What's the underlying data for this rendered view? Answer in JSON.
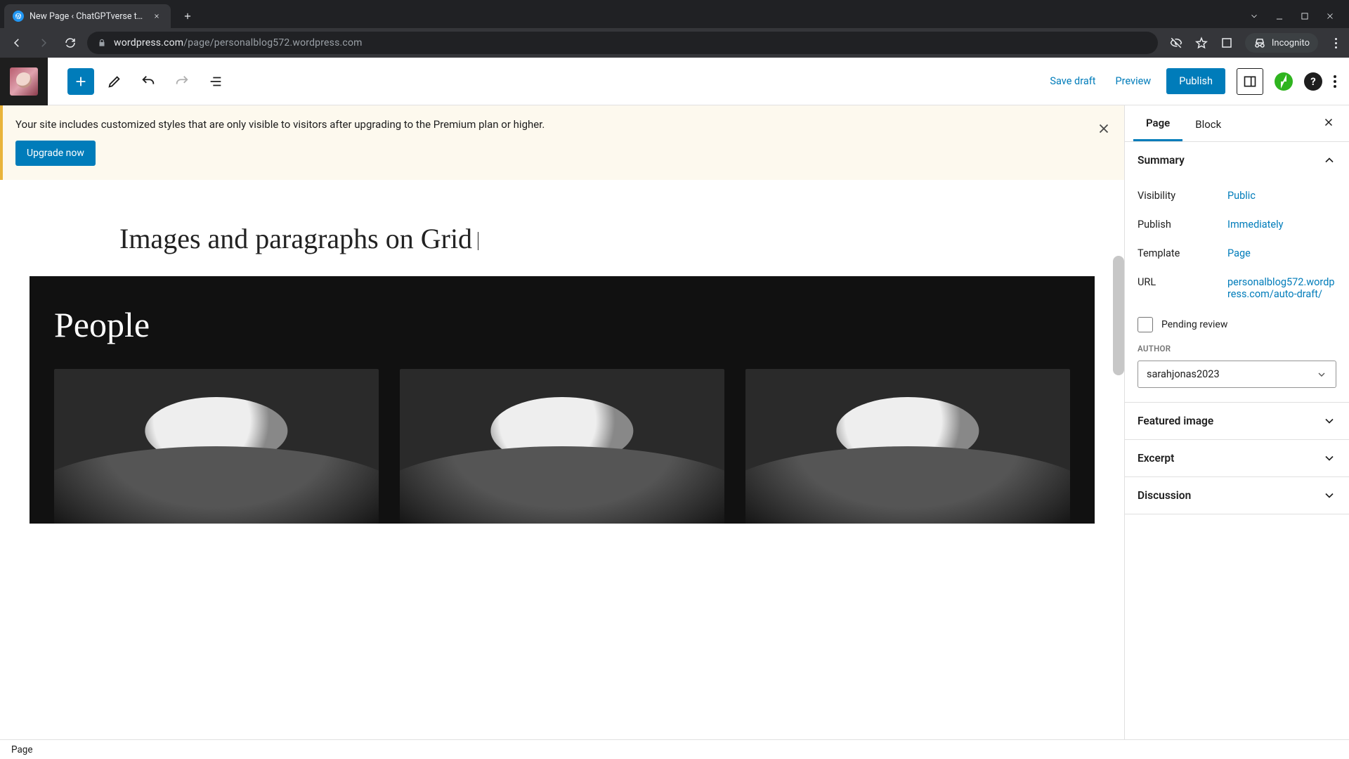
{
  "browser": {
    "tab_title": "New Page ‹ ChatGPTverse this ye",
    "url_host": "wordpress.com",
    "url_path": "/page/personalblog572.wordpress.com",
    "incognito_label": "Incognito"
  },
  "topbar": {
    "save_draft": "Save draft",
    "preview": "Preview",
    "publish": "Publish"
  },
  "notice": {
    "text": "Your site includes customized styles that are only visible to visitors after upgrading to the Premium plan or higher.",
    "cta": "Upgrade now"
  },
  "page": {
    "title": "Images and paragraphs on Grid",
    "block_heading": "People"
  },
  "sidebar": {
    "tabs": {
      "page": "Page",
      "block": "Block"
    },
    "summary": {
      "heading": "Summary",
      "visibility_label": "Visibility",
      "visibility_value": "Public",
      "publish_label": "Publish",
      "publish_value": "Immediately",
      "template_label": "Template",
      "template_value": "Page",
      "url_label": "URL",
      "url_value": "personalblog572.wordpress.com/auto-draft/",
      "pending_review": "Pending review",
      "author_label": "AUTHOR",
      "author_value": "sarahjonas2023"
    },
    "panels": {
      "featured_image": "Featured image",
      "excerpt": "Excerpt",
      "discussion": "Discussion"
    }
  },
  "status": {
    "breadcrumb": "Page"
  }
}
